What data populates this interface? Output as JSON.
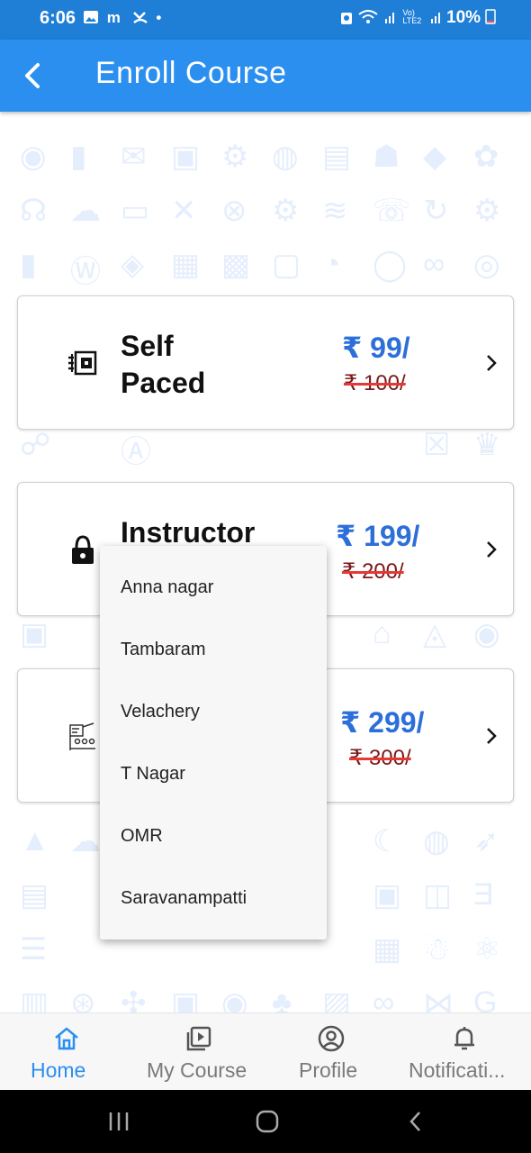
{
  "status_bar": {
    "time": "6:06",
    "left_icons": [
      "gallery-icon",
      "m-icon",
      "missed-call-icon",
      "dot-icon"
    ],
    "network": "Vo) LTE2",
    "battery": "10%"
  },
  "app_bar": {
    "title": "Enroll Course"
  },
  "courses": [
    {
      "title_line1": "Self",
      "title_line2": "Paced",
      "price": "₹ 99/",
      "old_price": "₹ 100/"
    },
    {
      "title_line1": "Instructor",
      "title_line2": "",
      "price": "₹ 199/",
      "old_price": "₹ 200/"
    },
    {
      "title_line1": "",
      "title_line2": "",
      "price": "₹ 299/",
      "old_price": "₹ 300/"
    }
  ],
  "dropdown": {
    "options": [
      "Anna nagar",
      "Tambaram",
      "Velachery",
      "T Nagar",
      "OMR",
      "Saravanampatti"
    ]
  },
  "bottom_nav": {
    "active_color": "#2b8ff0",
    "items": [
      {
        "label": "Home",
        "icon": "home-icon",
        "active": true
      },
      {
        "label": "My Course",
        "icon": "video-library-icon",
        "active": false
      },
      {
        "label": "Profile",
        "icon": "profile-icon",
        "active": false
      },
      {
        "label": "Notificati...",
        "icon": "bell-icon",
        "active": false
      }
    ]
  },
  "colors": {
    "status_bar": "#1f7fd6",
    "app_bar": "#2b8ff0",
    "price": "#2d6fd8",
    "strike": "#e53935"
  }
}
